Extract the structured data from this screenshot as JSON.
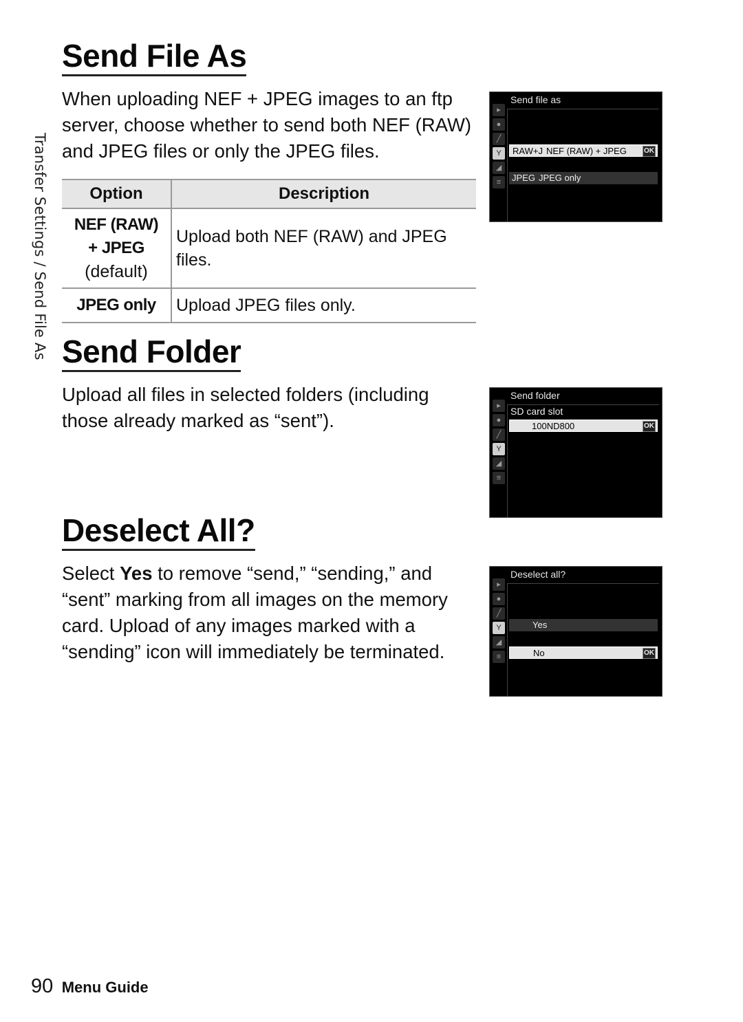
{
  "side_tab": "Transfer Settings / Send File As",
  "sections": {
    "send_file_as": {
      "heading": "Send File As",
      "body": "When uploading NEF + JPEG images to an ftp server, choose whether to send both NEF (RAW) and JPEG files or only the JPEG files.",
      "table": {
        "headers": [
          "Option",
          "Description"
        ],
        "rows": [
          {
            "option_line1": "NEF (RAW)",
            "option_line2": "+ JPEG",
            "option_note": "(default)",
            "description": "Upload both NEF (RAW) and JPEG files."
          },
          {
            "option_line1": "JPEG only",
            "description": "Upload JPEG files only."
          }
        ]
      },
      "screen": {
        "title": "Send file as",
        "items": [
          {
            "tag": "RAW+J",
            "label": "NEF (RAW) + JPEG",
            "selected": true
          },
          {
            "tag": "JPEG",
            "label": "JPEG only",
            "selected": false
          }
        ],
        "ok_label": "OK"
      }
    },
    "send_folder": {
      "heading": "Send Folder",
      "body": "Upload all files in selected folders (including those already marked as “sent”).",
      "screen": {
        "title": "Send folder",
        "subtitle": "SD card slot",
        "items": [
          {
            "label": "100ND800",
            "selected": true
          }
        ],
        "ok_label": "OK"
      }
    },
    "deselect_all": {
      "heading": "Deselect All?",
      "body_pre": "Select ",
      "body_bold": "Yes",
      "body_post": " to remove “send,” “sending,” and “sent” marking from all images on the memory card.  Upload of any images marked with a “sending” icon will immediately be terminated.",
      "screen": {
        "title": "Deselect all?",
        "items": [
          {
            "label": "Yes",
            "selected": false
          },
          {
            "label": "No",
            "selected": true
          }
        ],
        "ok_label": "OK"
      }
    }
  },
  "camera_menu_icons": [
    "playback-icon",
    "camera-icon",
    "pencil-icon",
    "wrench-icon",
    "retouch-icon",
    "my-menu-icon"
  ],
  "footer": {
    "page_number": "90",
    "section": "Menu Guide"
  }
}
